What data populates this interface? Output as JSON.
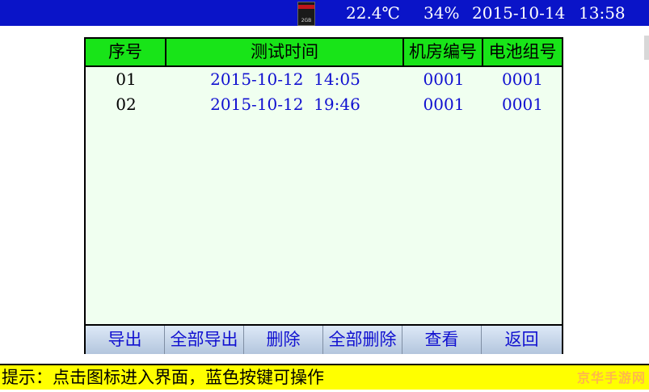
{
  "status": {
    "sd_card_label": "2GB",
    "temperature": "22.4℃",
    "humidity": "34%",
    "date": "2015-10-14",
    "time": "13:58",
    "bar_color": "#0a14c8"
  },
  "table": {
    "headers": [
      "序号",
      "测试时间",
      "机房编号",
      "电池组号"
    ],
    "rows": [
      {
        "index": "01",
        "test_time": "2015-10-12  14:05",
        "room_no": "0001",
        "group_no": "0001"
      },
      {
        "index": "02",
        "test_time": "2015-10-12  19:46",
        "room_no": "0001",
        "group_no": "0001"
      }
    ],
    "header_color": "#18e418"
  },
  "buttons": {
    "export": "导出",
    "export_all": "全部导出",
    "delete": "删除",
    "delete_all": "全部删除",
    "view": "查看",
    "back": "返回"
  },
  "hint": {
    "text": "提示：点击图标进入界面，蓝色按键可操作"
  },
  "watermark": "京华手游网"
}
